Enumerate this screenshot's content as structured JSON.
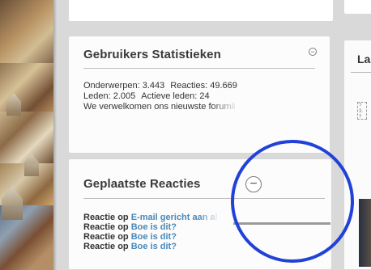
{
  "panels": {
    "stats": {
      "title": "Gebruikers Statistieken",
      "topics": "Onderwerpen: 3.443",
      "reactions": "Reacties: 49.669",
      "members": "Leden: 2.005",
      "active_members": "Actieve leden: 24",
      "welcome": "We verwelkomen ons nieuwste forumli"
    },
    "reacties": {
      "title": "Geplaatste Reacties",
      "items": [
        {
          "prefix": "Reactie op",
          "link": "E-mail gericht aan al"
        },
        {
          "prefix": "Reactie op",
          "link": "Boe is dit?"
        },
        {
          "prefix": "Reactie op",
          "link": "Boe is dit?"
        },
        {
          "prefix": "Reactie op",
          "link": "Boe is dit?"
        }
      ]
    },
    "right": {
      "title": "La",
      "thumb_text": "?\n3.\n?"
    }
  },
  "icons": {
    "collapse": "minus-circle-icon"
  },
  "colors": {
    "link": "#4a88b8",
    "annotation": "#2042d8"
  }
}
